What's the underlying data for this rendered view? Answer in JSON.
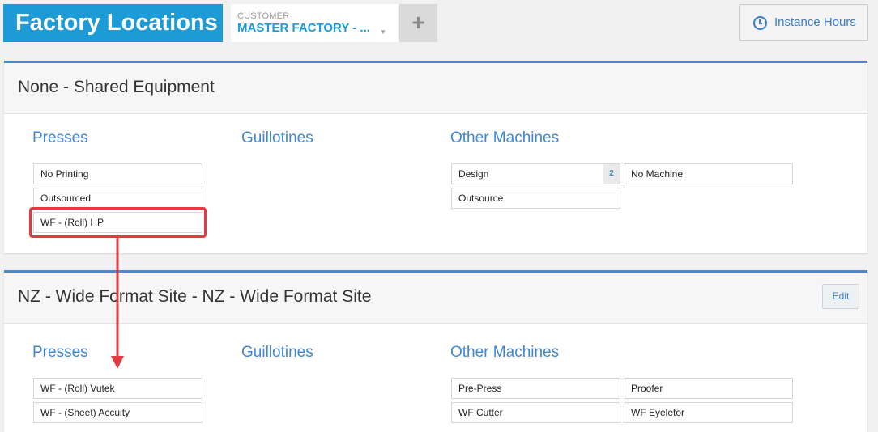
{
  "header": {
    "title": "Factory Locations",
    "customer_label": "CUSTOMER",
    "customer_value": "MASTER FACTORY - ...",
    "add_label": "+",
    "instance_hours_label": "Instance Hours"
  },
  "sections": [
    {
      "title": "None - Shared Equipment",
      "presses_title": "Presses",
      "guillotines_title": "Guillotines",
      "other_title": "Other Machines",
      "presses": [
        "No Printing",
        "Outsourced",
        "WF - (Roll) HP"
      ],
      "other": [
        {
          "label": "Design",
          "count": "2"
        },
        {
          "label": "No Machine"
        },
        {
          "label": "Outsource"
        }
      ]
    },
    {
      "title": "NZ - Wide Format Site - NZ - Wide Format Site",
      "edit_label": "Edit",
      "presses_title": "Presses",
      "guillotines_title": "Guillotines",
      "other_title": "Other Machines",
      "presses": [
        "WF - (Roll) Vutek",
        "WF - (Sheet) Accuity"
      ],
      "other": [
        {
          "label": "Pre-Press"
        },
        {
          "label": "Proofer"
        },
        {
          "label": "WF Cutter"
        },
        {
          "label": "WF Eyeletor"
        }
      ]
    }
  ],
  "colors": {
    "brand": "#1d9bd7",
    "accent": "#3f87d6",
    "annotation": "#e43a3f"
  }
}
